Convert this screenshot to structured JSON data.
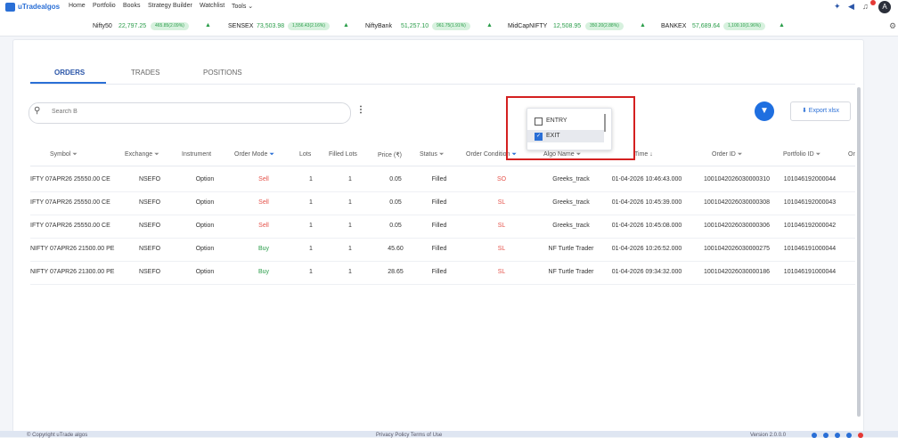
{
  "nav": {
    "logo": "uTradealgos",
    "items": [
      "Home",
      "Portfolio",
      "Books",
      "Strategy Builder",
      "Watchlist",
      "Tools ⌄"
    ],
    "avatar": "A"
  },
  "ticker": [
    {
      "name": "Nifty50",
      "value": "22,797.25",
      "change": "465.85(2.09%)"
    },
    {
      "name": "SENSEX",
      "value": "73,503.98",
      "change": "1,556.43(2.16%)"
    },
    {
      "name": "NiftyBank",
      "value": "51,257.10",
      "change": "961.75(1.91%)"
    },
    {
      "name": "MidCapNIFTY",
      "value": "12,508.95",
      "change": "350.20(2.88%)"
    },
    {
      "name": "BANKEX",
      "value": "57,689.64",
      "change": "1,100.10(1.96%)"
    }
  ],
  "tabs": [
    "ORDERS",
    "TRADES",
    "POSITIONS"
  ],
  "search": {
    "placeholder": "Search B"
  },
  "export_label": "Export xlsx",
  "table": {
    "headers": [
      "Symbol",
      "Exchange",
      "Instrument",
      "Order Mode",
      "Lots",
      "Filled Lots",
      "Price (₹)",
      "Status",
      "Order Condition",
      "Algo Name",
      "Time",
      "Order ID",
      "Portfolio ID",
      "Or"
    ],
    "rows": [
      [
        "IFTY 07APR26 25550.00 CE",
        "NSEFO",
        "Option",
        "Sell",
        "1",
        "1",
        "0.05",
        "Filled",
        "SO",
        "Greeks_track",
        "01-04-2026 10:46:43.000",
        "1001042026030000310",
        "101046192000044"
      ],
      [
        "IFTY 07APR26 25550.00 CE",
        "NSEFO",
        "Option",
        "Sell",
        "1",
        "1",
        "0.05",
        "Filled",
        "SL",
        "Greeks_track",
        "01-04-2026 10:45:39.000",
        "1001042026030000308",
        "101046192000043"
      ],
      [
        "IFTY 07APR26 25550.00 CE",
        "NSEFO",
        "Option",
        "Sell",
        "1",
        "1",
        "0.05",
        "Filled",
        "SL",
        "Greeks_track",
        "01-04-2026 10:45:08.000",
        "1001042026030000306",
        "101046192000042"
      ],
      [
        "NIFTY 07APR26 21500.00 PE",
        "NSEFO",
        "Option",
        "Buy",
        "1",
        "1",
        "45.60",
        "Filled",
        "SL",
        "NF Turtle Trader",
        "01-04-2026 10:26:52.000",
        "1001042026030000275",
        "101046191000044"
      ],
      [
        "NIFTY 07APR26 21300.00 PE",
        "NSEFO",
        "Option",
        "Buy",
        "1",
        "1",
        "28.65",
        "Filled",
        "SL",
        "NF Turtle Trader",
        "01-04-2026 09:34:32.000",
        "1001042026030000186",
        "101046191000044"
      ]
    ]
  },
  "dropdown": {
    "options": [
      "ENTRY",
      "EXIT"
    ],
    "checked": "EXIT"
  },
  "footer": {
    "copyright": "© Copyright uTrade algos",
    "links": "Privacy Policy   Terms of Use",
    "version": "Version 2.0.0.0"
  },
  "colors": {
    "accent": "#2a6fd6",
    "sell": "#e5534b",
    "buy": "#2a9d4a",
    "highlight": "#d42020"
  }
}
